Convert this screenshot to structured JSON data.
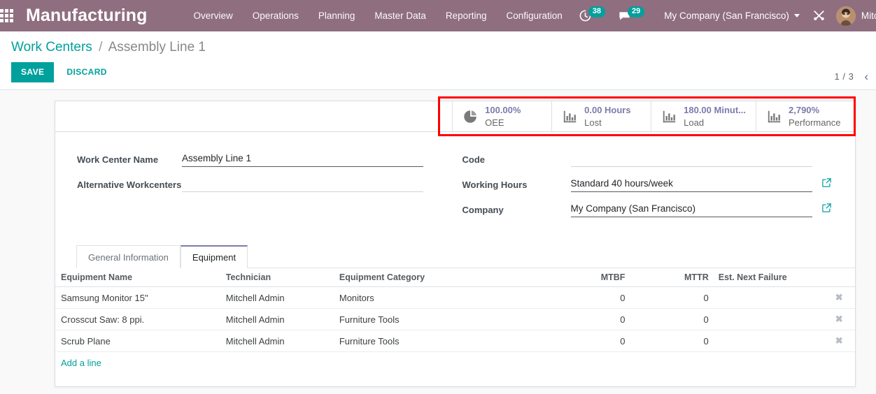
{
  "navbar": {
    "apps_icon": "grid-apps-icon",
    "brand": "Manufacturing",
    "menu": [
      {
        "label": "Overview"
      },
      {
        "label": "Operations"
      },
      {
        "label": "Planning"
      },
      {
        "label": "Master Data"
      },
      {
        "label": "Reporting"
      },
      {
        "label": "Configuration"
      }
    ],
    "activities": {
      "icon": "clock-icon",
      "count": "38"
    },
    "messages": {
      "icon": "chat-bubble-icon",
      "count": "29"
    },
    "company": "My Company (San Francisco)",
    "debug_icon": "wrench-screwdriver-icon",
    "user": "Mitchell Adm",
    "brand_color": "#8f6e80",
    "badge_color": "#00a09d"
  },
  "control_panel": {
    "breadcrumb_root": "Work Centers",
    "breadcrumb_sep": "/",
    "breadcrumb_current": "Assembly Line 1",
    "save_label": "SAVE",
    "discard_label": "DISCARD",
    "pager_counter": "1 / 3",
    "pager_prev": "‹",
    "accent_color": "#00a09d"
  },
  "stat_buttons": [
    {
      "icon": "pie-chart-icon",
      "value": "100.00%",
      "label": "OEE"
    },
    {
      "icon": "bar-chart-icon",
      "value": "0.00 Hours",
      "label": "Lost"
    },
    {
      "icon": "bar-chart-icon",
      "value": "180.00 Minut...",
      "label": "Load"
    },
    {
      "icon": "bar-chart-icon",
      "value": "2,790%",
      "label": "Performance"
    }
  ],
  "highlight": {
    "color": "#ff0000"
  },
  "form": {
    "left": [
      {
        "label": "Work Center Name",
        "value": "Assembly Line 1",
        "type": "text",
        "filled": true
      },
      {
        "label": "Alternative Workcenters",
        "value": "",
        "type": "select",
        "filled": false
      }
    ],
    "right": [
      {
        "label": "Code",
        "value": "",
        "type": "text",
        "filled": false
      },
      {
        "label": "Working Hours",
        "value": "Standard 40 hours/week",
        "type": "select",
        "filled": true,
        "external": true
      },
      {
        "label": "Company",
        "value": "My Company (San Francisco)",
        "type": "select",
        "filled": true,
        "external": true
      }
    ]
  },
  "notebook": {
    "tabs": [
      {
        "label": "General Information",
        "active": false
      },
      {
        "label": "Equipment",
        "active": true
      }
    ]
  },
  "table": {
    "headers": [
      "Equipment Name",
      "Technician",
      "Equipment Category",
      "MTBF",
      "MTTR",
      "Est. Next Failure"
    ],
    "rows": [
      {
        "name": "Samsung Monitor 15\"",
        "technician": "Mitchell Admin",
        "category": "Monitors",
        "mtbf": "0",
        "mttr": "0",
        "next_failure": ""
      },
      {
        "name": "Crosscut Saw: 8 ppi.",
        "technician": "Mitchell Admin",
        "category": "Furniture Tools",
        "mtbf": "0",
        "mttr": "0",
        "next_failure": ""
      },
      {
        "name": "Scrub Plane",
        "technician": "Mitchell Admin",
        "category": "Furniture Tools",
        "mtbf": "0",
        "mttr": "0",
        "next_failure": ""
      }
    ],
    "delete_icon": "x-remove-icon",
    "add_line_label": "Add a line"
  }
}
